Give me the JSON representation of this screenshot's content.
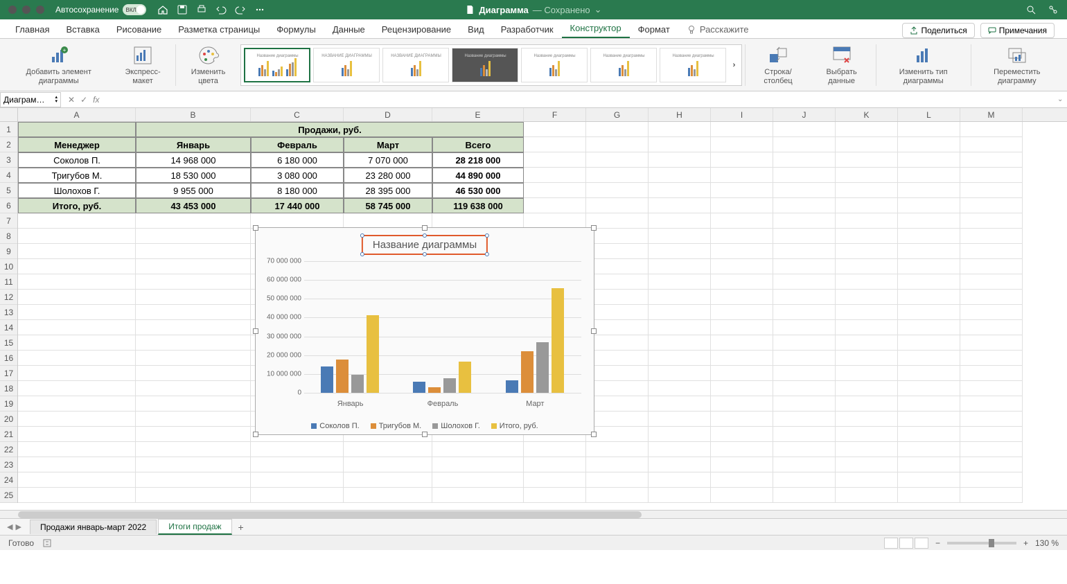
{
  "titlebar": {
    "autosave_label": "Автосохранение",
    "autosave_toggle": "ВКЛ.",
    "filename": "Диаграмма",
    "saved_label": "— Сохранено"
  },
  "tabs": {
    "home": "Главная",
    "insert": "Вставка",
    "draw": "Рисование",
    "layout": "Разметка страницы",
    "formulas": "Формулы",
    "data": "Данные",
    "review": "Рецензирование",
    "view": "Вид",
    "developer": "Разработчик",
    "design": "Конструктор",
    "format": "Формат",
    "tell_me": "Расскажите"
  },
  "ribbon_right": {
    "share": "Поделиться",
    "comments": "Примечания"
  },
  "ribbon": {
    "add_element": "Добавить элемент\nдиаграммы",
    "quick_layout": "Экспресс-макет",
    "change_colors": "Изменить\nцвета",
    "style_caption": "Название диаграммы",
    "style_alt": "НАЗВАНИЕ ДИАГРАММЫ",
    "switch_rowcol": "Строка/столбец",
    "select_data": "Выбрать\nданные",
    "change_type": "Изменить тип\nдиаграммы",
    "move_chart": "Переместить\nдиаграмму"
  },
  "namebox": "Диаграм…",
  "fx": "fx",
  "columns": [
    "A",
    "B",
    "C",
    "D",
    "E",
    "F",
    "G",
    "H",
    "I",
    "J",
    "K",
    "L",
    "M"
  ],
  "col_widths": [
    "wA",
    "wB",
    "wC",
    "wD",
    "wE",
    "wO",
    "wO",
    "wO",
    "wO",
    "wO",
    "wO",
    "wO",
    "wO"
  ],
  "rows": 25,
  "table": {
    "header_main": "Продажи, руб.",
    "col1": "Менеджер",
    "months": [
      "Январь",
      "Февраль",
      "Март",
      "Всего"
    ],
    "data": [
      {
        "name": "Соколов П.",
        "vals": [
          "14 968 000",
          "6 180 000",
          "7 070 000",
          "28 218 000"
        ]
      },
      {
        "name": "Тригубов М.",
        "vals": [
          "18 530 000",
          "3 080 000",
          "23 280 000",
          "44 890 000"
        ]
      },
      {
        "name": "Шолохов Г.",
        "vals": [
          "9 955 000",
          "8 180 000",
          "28 395 000",
          "46 530 000"
        ]
      }
    ],
    "total_label": "Итого, руб.",
    "totals": [
      "43 453 000",
      "17 440 000",
      "58 745 000",
      "119 638 000"
    ]
  },
  "chart_data": {
    "type": "bar",
    "title": "Название диаграммы",
    "categories": [
      "Январь",
      "Февраль",
      "Март"
    ],
    "series": [
      {
        "name": "Соколов П.",
        "color": "#4a7ab5",
        "values": [
          14968000,
          6180000,
          7070000
        ]
      },
      {
        "name": "Тригубов М.",
        "color": "#dc8e3a",
        "values": [
          18530000,
          3080000,
          23280000
        ]
      },
      {
        "name": "Шолохов Г.",
        "color": "#999999",
        "values": [
          9955000,
          8180000,
          28395000
        ]
      },
      {
        "name": "Итого, руб.",
        "color": "#e8c040",
        "values": [
          43453000,
          17440000,
          58745000
        ]
      }
    ],
    "ylim": [
      0,
      70000000
    ],
    "yticks": [
      "0",
      "10 000 000",
      "20 000 000",
      "30 000 000",
      "40 000 000",
      "50 000 000",
      "60 000 000",
      "70 000 000"
    ]
  },
  "sheets": {
    "s1": "Продажи январь-март 2022",
    "s2": "Итоги продаж"
  },
  "status": {
    "ready": "Готово",
    "zoom": "130 %"
  }
}
